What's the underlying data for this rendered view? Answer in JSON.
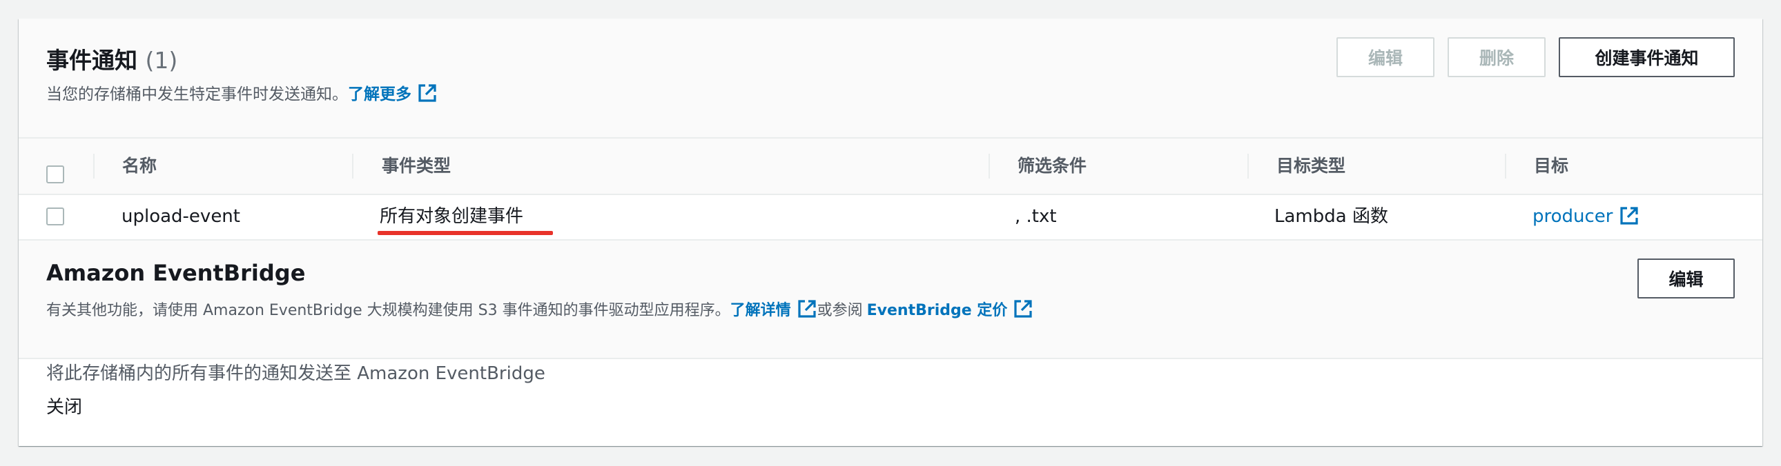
{
  "event_notifications": {
    "title": "事件通知",
    "count": "(1)",
    "description": "当您的存储桶中发生特定事件时发送通知。",
    "learn_more": "了解更多",
    "buttons": {
      "edit": "编辑",
      "delete": "删除",
      "create": "创建事件通知"
    },
    "columns": [
      "名称",
      "事件类型",
      "筛选条件",
      "目标类型",
      "目标"
    ],
    "rows": [
      {
        "name": "upload-event",
        "event_type": "所有对象创建事件",
        "filter": ", .txt",
        "destination_type": "Lambda 函数",
        "destination": "producer"
      }
    ]
  },
  "eventbridge": {
    "title": "Amazon EventBridge",
    "description": "有关其他功能，请使用 Amazon EventBridge 大规模构建使用 S3 事件通知的事件驱动型应用程序。",
    "learn_details": "了解详情",
    "or_see": "或参阅",
    "pricing_link": "EventBridge 定价",
    "edit_button": "编辑",
    "setting_label": "将此存储桶内的所有事件的通知发送至 Amazon EventBridge",
    "setting_value": "关闭"
  },
  "colors": {
    "link": "#0073bb",
    "annotation": "#e8322a"
  },
  "icons": {
    "external_link": "external-link-icon"
  }
}
